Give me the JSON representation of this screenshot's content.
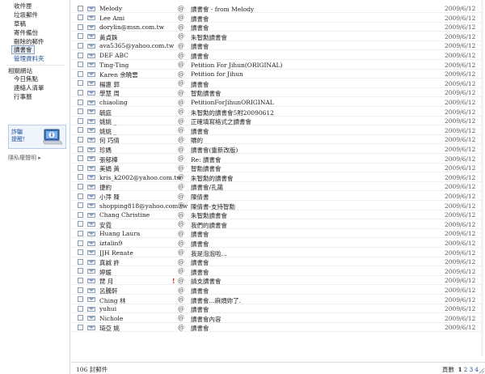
{
  "sidebar": {
    "folders": [
      {
        "label": "收件匣"
      },
      {
        "label": "垃圾郵件"
      },
      {
        "label": "草稿"
      },
      {
        "label": "寄件備份"
      },
      {
        "label": "刪除的郵件"
      },
      {
        "label": "讀書會",
        "selected": true
      },
      {
        "label": "管理資料夾",
        "manage": true
      }
    ],
    "related_title": "相關網站",
    "related_links": [
      {
        "label": "今日焦點"
      },
      {
        "label": "連絡人清單"
      },
      {
        "label": "行事曆"
      }
    ],
    "ad": {
      "line1": "詐騙",
      "line2": "提醒！",
      "icon": "info-laptop-icon"
    },
    "privacy_label": "隱私權聲明 ▸"
  },
  "messages": [
    {
      "from": "Melody",
      "subject": "讀書會 - from Melody",
      "date": "2009/6/12",
      "attach": true
    },
    {
      "from": "Lee Ami",
      "subject": "讀書會",
      "date": "2009/6/12",
      "attach": true
    },
    {
      "from": "dorylin@msn.com.tw",
      "subject": "讀書會",
      "date": "2009/6/12",
      "attach": true
    },
    {
      "from": "黃貞銖",
      "subject": "朱智勳讀書會",
      "date": "2009/6/12",
      "attach": true
    },
    {
      "from": "ava5365@yahoo.com.tw",
      "subject": "讀書會",
      "date": "2009/6/12",
      "attach": true
    },
    {
      "from": "DEF ABC",
      "subject": "讀書會",
      "date": "2009/6/12",
      "attach": true
    },
    {
      "from": "Ting-Ting",
      "subject": "Petition For Jihun(ORIGINAL)",
      "date": "2009/6/12",
      "attach": true
    },
    {
      "from": "Karen 余曉雲",
      "subject": "Petition for Jihun",
      "date": "2009/6/12",
      "attach": true
    },
    {
      "from": "楊惠 郭",
      "subject": "讀書會",
      "date": "2009/6/12",
      "attach": true
    },
    {
      "from": "學慧 周",
      "subject": "智勳讀書會",
      "date": "2009/6/12",
      "attach": true
    },
    {
      "from": "chiaoling",
      "subject": "PetitionForJihunORIGINAL",
      "date": "2009/6/12",
      "attach": true
    },
    {
      "from": "毓庭",
      "subject": "朱智勳的讀書會5附20090612",
      "date": "2009/6/12",
      "attach": true
    },
    {
      "from": "姚姚 _",
      "subject": "正確填寫格式之讀書會",
      "date": "2009/6/12",
      "attach": true
    },
    {
      "from": "姚姚 _",
      "subject": "讀書會",
      "date": "2009/6/12",
      "attach": true
    },
    {
      "from": "何 巧倩",
      "subject": "贖的",
      "date": "2009/6/12",
      "attach": true
    },
    {
      "from": "珍媽",
      "subject": "讀書會(重新改版)",
      "date": "2009/6/12",
      "attach": true
    },
    {
      "from": "張郁樺",
      "subject": "Re: 讀書會",
      "date": "2009/6/12",
      "attach": true
    },
    {
      "from": "美娟 黃",
      "subject": "智勳讀書會",
      "date": "2009/6/12",
      "attach": true
    },
    {
      "from": "kris_k2002@yahoo.com.tw",
      "subject": "朱智勳的讀書會",
      "date": "2009/6/12",
      "attach": true
    },
    {
      "from": "捷約",
      "subject": "讀書會/孔藹",
      "date": "2009/6/12",
      "attach": true
    },
    {
      "from": "小萍 陳",
      "subject": "陳倩書",
      "date": "2009/6/12",
      "attach": true
    },
    {
      "from": "shopping818@yahoo.com.tw",
      "subject": "陳倩書-支持智勳",
      "date": "2009/6/12",
      "attach": true
    },
    {
      "from": "Chang Christine",
      "subject": "朱智勳讀書會",
      "date": "2009/6/12",
      "attach": true
    },
    {
      "from": "安霓",
      "subject": "我們的讀書會",
      "date": "2009/6/12",
      "attach": true
    },
    {
      "from": "Huang Laura",
      "subject": "讀書會",
      "date": "2009/6/12",
      "attach": true
    },
    {
      "from": "iztalin9",
      "subject": "讀書會",
      "date": "2009/6/12",
      "attach": true
    },
    {
      "from": "JJH Renate",
      "subject": "我是泡泡啦...",
      "date": "2009/6/12",
      "attach": true
    },
    {
      "from": "真誠 許",
      "subject": "讀書會",
      "date": "2009/6/12",
      "attach": true
    },
    {
      "from": "婷媛",
      "subject": "讀書會",
      "date": "2009/6/12",
      "attach": true
    },
    {
      "from": "琵 月",
      "subject": "請支讀書會",
      "date": "2009/6/12",
      "attach": true,
      "flag": true
    },
    {
      "from": "呂騰軒",
      "subject": "讀書會",
      "date": "2009/6/12",
      "attach": true
    },
    {
      "from": "Ching 林",
      "subject": "讀書會...麻煩妳了.",
      "date": "2009/6/12",
      "attach": true
    },
    {
      "from": "yuhui",
      "subject": "讀書會",
      "date": "2009/6/12",
      "attach": true
    },
    {
      "from": "Nichole",
      "subject": "讀書會內容",
      "date": "2009/6/12",
      "attach": true
    },
    {
      "from": "琦亞 姚",
      "subject": "讀書會",
      "date": "2009/6/12",
      "attach": true
    }
  ],
  "glyphs": {
    "attach": "@",
    "flag": "!"
  },
  "footer": {
    "count": "106 封郵件",
    "pages_label": "頁數",
    "pages": [
      "1",
      "2",
      "3",
      "4"
    ],
    "current_page": "1"
  }
}
